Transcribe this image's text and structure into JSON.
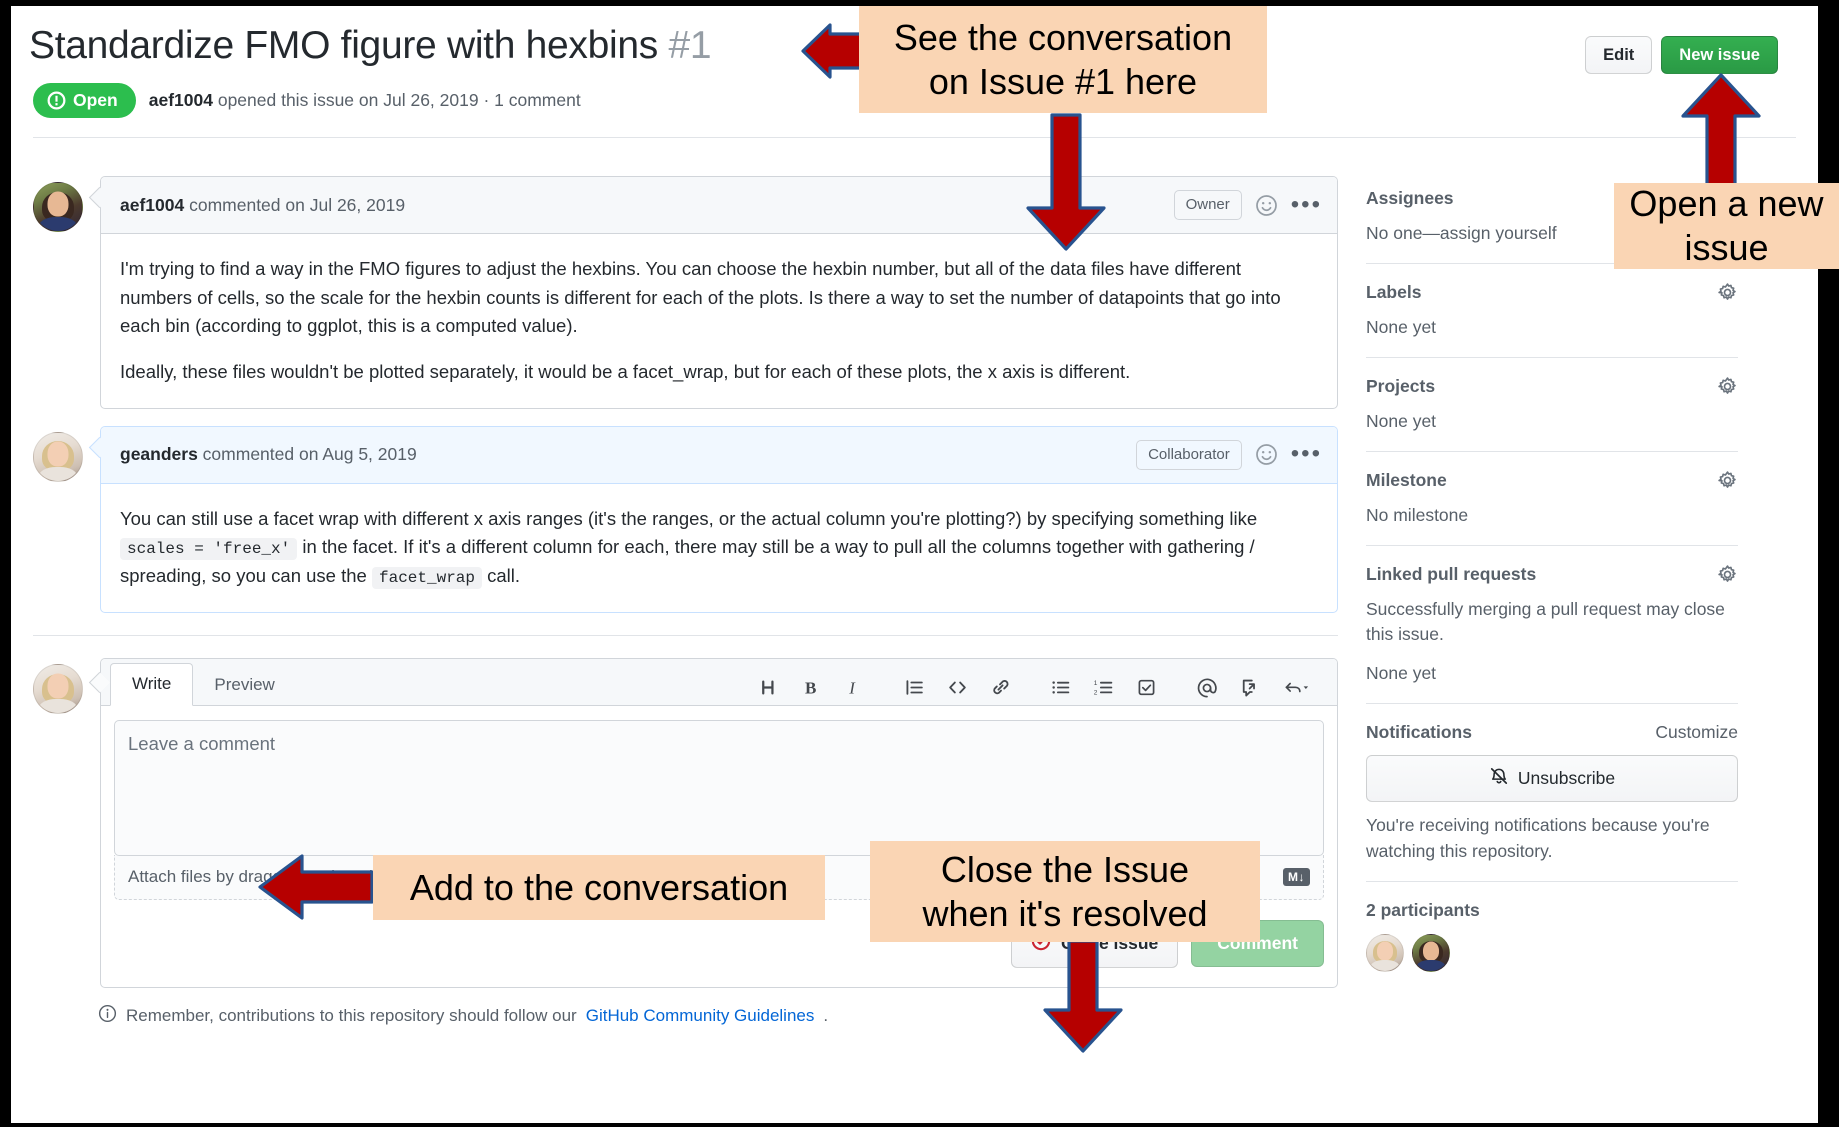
{
  "header": {
    "title": "Standardize FMO figure with hexbins",
    "issue_number": "#1",
    "state_label": "Open",
    "meta_author": "aef1004",
    "meta_rest": " opened this issue on Jul 26, 2019 · 1 comment",
    "edit_label": "Edit",
    "new_issue_label": "New issue"
  },
  "comments": [
    {
      "author": "aef1004",
      "meta": " commented on Jul 26, 2019",
      "role": "Owner",
      "avatar_style": "a-dark",
      "paragraphs": [
        "I'm trying to find a way in the FMO figures to adjust the hexbins. You can choose the hexbin number, but all of the data files have different numbers of cells, so the scale for the hexbin counts is different for each of the plots. Is there a way to set the number of datapoints that go into each bin (according to ggplot, this is a computed value).",
        "Ideally, these files wouldn't be plotted separately, it would be a facet_wrap, but for each of these plots, the x axis is different."
      ]
    },
    {
      "author": "geanders",
      "meta": " commented on Aug 5, 2019",
      "role": "Collaborator",
      "avatar_style": "a-light",
      "rich": {
        "t1": "You can still use a facet wrap with different x axis ranges (it's the ranges, or the actual column you're plotting?) by specifying something like ",
        "code1": "scales = 'free_x'",
        "t2": " in the facet. If it's a different column for each, there may still be a way to pull all the columns together with gathering / spreading, so you can use the ",
        "code2": "facet_wrap",
        "t3": " call."
      }
    }
  ],
  "editor": {
    "tab_write": "Write",
    "tab_preview": "Preview",
    "placeholder": "Leave a comment",
    "attach_text": "Attach files by dragging & dropping, selecting or pasting them.",
    "markdown_badge": "M↓",
    "close_issue_label": "Close issue",
    "comment_label": "Comment",
    "tools": [
      "heading-icon",
      "bold-icon",
      "italic-icon",
      "quote-icon",
      "code-icon",
      "link-icon",
      "unordered-list-icon",
      "ordered-list-icon",
      "task-list-icon",
      "mention-icon",
      "cross-reference-icon",
      "reply-icon"
    ]
  },
  "footer": {
    "prefix": "Remember, contributions to this repository should follow our ",
    "link": "GitHub Community Guidelines",
    "suffix": "."
  },
  "sidebar": {
    "assignees": {
      "title": "Assignees",
      "value": "No one—assign yourself"
    },
    "labels": {
      "title": "Labels",
      "value": "None yet"
    },
    "projects": {
      "title": "Projects",
      "value": "None yet"
    },
    "milestone": {
      "title": "Milestone",
      "value": "No milestone"
    },
    "linked_prs": {
      "title": "Linked pull requests",
      "value": "Successfully merging a pull request may close this issue.",
      "value2": "None yet"
    },
    "notifications": {
      "title": "Notifications",
      "customize": "Customize",
      "button": "Unsubscribe",
      "note": "You're receiving notifications because you're watching this repository."
    },
    "participants": {
      "title": "2 participants"
    }
  },
  "annotations": {
    "callout1": "See the conversation\non Issue #1 here",
    "callout2": "Open a new\nissue",
    "callout3": "Add to the conversation",
    "callout4": "Close the Issue\nwhen it's resolved"
  },
  "colors": {
    "callout_bg": "#fad5b4",
    "arrow_fill": "#b60000",
    "arrow_stroke": "#28538f",
    "open_green": "#2cbe4e",
    "link_blue": "#0366d6"
  }
}
